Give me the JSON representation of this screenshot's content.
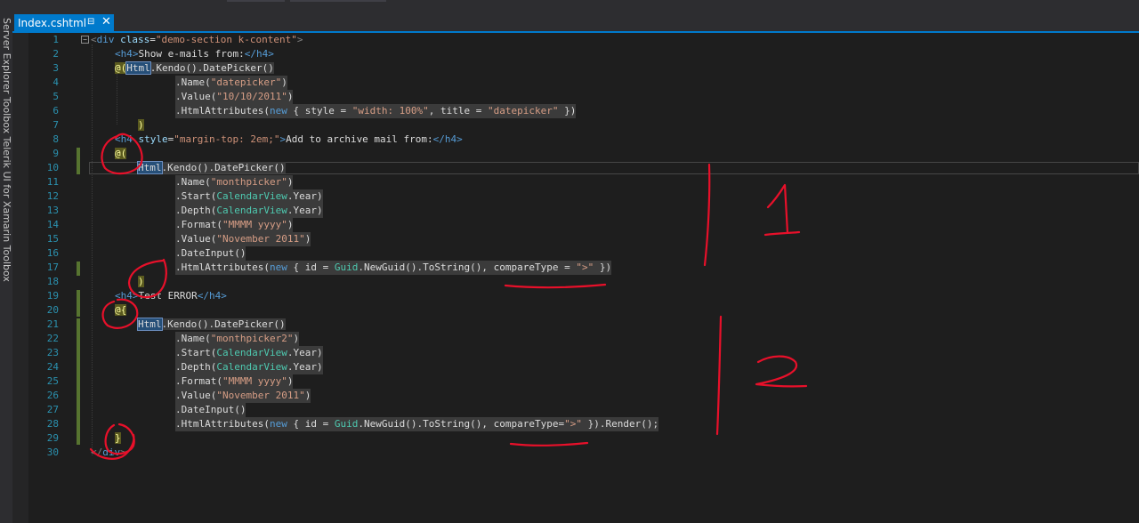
{
  "tab": {
    "title": "Index.cshtml",
    "pin_glyph": "⊟",
    "close_glyph": "✕"
  },
  "sidebar": {
    "text": "Server Explorer  Toolbox  Telerik UI for Xamarin Toolbox"
  },
  "line_numbers": [
    "1",
    "2",
    "3",
    "4",
    "5",
    "6",
    "7",
    "8",
    "9",
    "10",
    "11",
    "12",
    "13",
    "14",
    "15",
    "16",
    "17",
    "18",
    "19",
    "20",
    "21",
    "22",
    "23",
    "24",
    "25",
    "26",
    "27",
    "28",
    "29",
    "30"
  ],
  "code": {
    "l1_open": "<",
    "l1_div": "div",
    "l1_class": "class",
    "l1_eq": "=",
    "l1_val": "\"demo-section k-content\"",
    "l1_close": ">",
    "l2_h4o": "<h4>",
    "l2_text": "Show e-mails from:",
    "l2_h4c": "</h4>",
    "l3_at": "@(",
    "l3_html": "Html",
    "l3_rest": ".Kendo().DatePicker()",
    "l4_a": ".Name(",
    "l4_s": "\"datepicker\"",
    "l4_b": ")",
    "l5_a": ".Value(",
    "l5_s": "\"10/10/2011\"",
    "l5_b": ")",
    "l6_a": ".HtmlAttributes(",
    "l6_new": "new",
    "l6_b": " { style = ",
    "l6_s1": "\"width: 100%\"",
    "l6_c": ", title = ",
    "l6_s2": "\"datepicker\"",
    "l6_d": " })",
    "l7_brace": ")",
    "l8_h4o": "<h4",
    "l8_attr": " style",
    "l8_eq": "=",
    "l8_val": "\"margin-top: 2em;\"",
    "l8_gt": ">",
    "l8_text": "Add to archive mail from:",
    "l8_h4c": "</h4>",
    "l9_at": "@(",
    "l10_html": "Html",
    "l10_rest": ".Kendo().DatePicker()",
    "l11_a": ".Name(",
    "l11_s": "\"monthpicker\"",
    "l11_b": ")",
    "l12_a": ".Start(",
    "l12_t": "CalendarView",
    "l12_b": ".Year)",
    "l13_a": ".Depth(",
    "l13_t": "CalendarView",
    "l13_b": ".Year)",
    "l14_a": ".Format(",
    "l14_s": "\"MMMM yyyy\"",
    "l14_b": ")",
    "l15_a": ".Value(",
    "l15_s": "\"November 2011\"",
    "l15_b": ")",
    "l16_a": ".DateInput()",
    "l17_a": ".HtmlAttributes(",
    "l17_new": "new",
    "l17_b": " { id = ",
    "l17_t": "Guid",
    "l17_c": ".NewGuid().ToString(), compareType = ",
    "l17_s": "\">\"",
    "l17_d": " })",
    "l18_brace": ")",
    "l19_h4o": "<h4>",
    "l19_text": "Test ERROR",
    "l19_h4c": "</h4>",
    "l20_at": "@{",
    "l21_html": "Html",
    "l21_rest": ".Kendo().DatePicker()",
    "l22_a": ".Name(",
    "l22_s": "\"monthpicker2\"",
    "l22_b": ")",
    "l23_a": ".Start(",
    "l23_t": "CalendarView",
    "l23_b": ".Year)",
    "l24_a": ".Depth(",
    "l24_t": "CalendarView",
    "l24_b": ".Year)",
    "l25_a": ".Format(",
    "l25_s": "\"MMMM yyyy\"",
    "l25_b": ")",
    "l26_a": ".Value(",
    "l26_s": "\"November 2011\"",
    "l26_b": ")",
    "l27_a": ".DateInput()",
    "l28_a": ".HtmlAttributes(",
    "l28_new": "new",
    "l28_b": " { id = ",
    "l28_t": "Guid",
    "l28_c": ".NewGuid().ToString(), compareType=",
    "l28_s": "\">\"",
    "l28_d": " }).Render();",
    "l29_brace": "}",
    "l30_open": "</",
    "l30_div": "div",
    "l30_close": ">"
  },
  "annotations": {
    "label_1": "1",
    "label_2": "2",
    "ink_color": "#e8102a"
  },
  "colors": {
    "accent": "#007acc",
    "background": "#1e1e1e",
    "line_number": "#2b91af"
  }
}
